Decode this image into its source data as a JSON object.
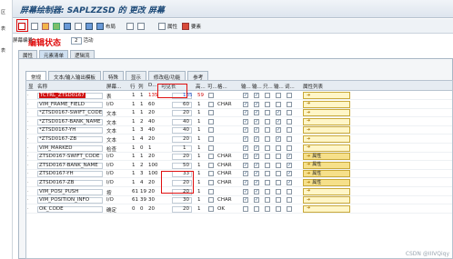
{
  "left_strip": [
    "区",
    "表",
    "表"
  ],
  "title": "屏幕绘制器: SAPLZZSD 的 更改 屏幕",
  "toolbar": {
    "layout_label": "布局",
    "attributes_label": "属性",
    "elements_label": "要素"
  },
  "annotation_text": "编辑状态",
  "screen_label": "屏幕编号",
  "screen_number": "2",
  "active_label": "活动",
  "tabs_top": [
    "属性",
    "元素清单",
    "逻辑流"
  ],
  "tabs_sub": [
    "常规",
    "文本/输入输出模板",
    "特殊",
    "显示",
    "修改组/功能",
    "参考"
  ],
  "columns": [
    "显",
    "名称",
    "屏幕...",
    "行",
    "列",
    "D...",
    "可见长",
    "高...",
    "可...",
    "格...",
    "输...",
    "输...",
    "只...",
    "输...",
    "词...",
    "属性列表"
  ],
  "rows": [
    {
      "name": "TCTRL_ZTSD0167",
      "type": "表",
      "row": "1",
      "col": "1",
      "def": "135",
      "vis": "135",
      "h": "59",
      "fmt": "",
      "style": "red",
      "attr": ""
    },
    {
      "name": "VIM_FRAME_FIELD",
      "type": "I/O",
      "row": "1",
      "col": "1",
      "def": "60",
      "vis": "60",
      "h": "1",
      "fmt": "CHAR",
      "style": "",
      "attr": ""
    },
    {
      "name": "*ZTSD0167-SWIFT_CODE",
      "type": "文本",
      "row": "1",
      "col": "1",
      "def": "20",
      "vis": "20",
      "h": "1",
      "fmt": "",
      "style": "",
      "attr": ""
    },
    {
      "name": "*ZTSD0167-BANK_NAME",
      "type": "文本",
      "row": "1",
      "col": "2",
      "def": "40",
      "vis": "40",
      "h": "1",
      "fmt": "",
      "style": "",
      "attr": ""
    },
    {
      "name": "*ZTSD0167-YH",
      "type": "文本",
      "row": "1",
      "col": "3",
      "def": "40",
      "vis": "40",
      "h": "1",
      "fmt": "",
      "style": "",
      "attr": ""
    },
    {
      "name": "*ZTSD0167-ZB",
      "type": "文本",
      "row": "1",
      "col": "4",
      "def": "20",
      "vis": "20",
      "h": "1",
      "fmt": "",
      "style": "",
      "attr": ""
    },
    {
      "name": "VIM_MARKED",
      "type": "检查",
      "row": "1",
      "col": "0",
      "def": "1",
      "vis": "1",
      "h": "1",
      "fmt": "",
      "style": "",
      "attr": ""
    },
    {
      "name": "ZTSD0167-SWIFT_CODE",
      "type": "I/O",
      "row": "1",
      "col": "1",
      "def": "20",
      "vis": "20",
      "h": "1",
      "fmt": "CHAR",
      "style": "",
      "attr": "属性"
    },
    {
      "name": "ZTSD0167-BANK_NAME",
      "type": "I/O",
      "row": "1",
      "col": "2",
      "def": "100",
      "vis": "50",
      "h": "1",
      "fmt": "CHAR",
      "style": "",
      "attr": "属性"
    },
    {
      "name": "ZTSD0167-YH",
      "type": "I/O",
      "row": "1",
      "col": "3",
      "def": "100",
      "vis": "33",
      "h": "1",
      "fmt": "CHAR",
      "style": "",
      "attr": "属性"
    },
    {
      "name": "ZTSD0167-ZB",
      "type": "I/O",
      "row": "1",
      "col": "4",
      "def": "20",
      "vis": "20",
      "h": "1",
      "fmt": "CHAR",
      "style": "",
      "attr": "属性"
    },
    {
      "name": "VIM_POSI_PUSH",
      "type": "按",
      "row": "61",
      "col": "19",
      "def": "20",
      "vis": "20",
      "h": "1",
      "fmt": "",
      "style": "",
      "attr": ""
    },
    {
      "name": "VIM_POSITION_INFO",
      "type": "I/O",
      "row": "61",
      "col": "39",
      "def": "30",
      "vis": "30",
      "h": "1",
      "fmt": "CHAR",
      "style": "",
      "attr": ""
    },
    {
      "name": "OK_CODE",
      "type": "确定",
      "row": "0",
      "col": "0",
      "def": "20",
      "vis": "20",
      "h": "1",
      "fmt": "OK",
      "style": "",
      "attr": ""
    }
  ],
  "watermark": "CSDN @IIIVQiqy"
}
